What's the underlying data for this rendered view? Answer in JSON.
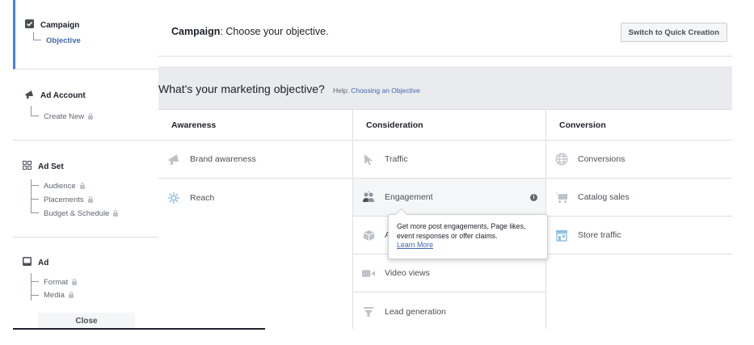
{
  "sidebar": {
    "campaign": {
      "title": "Campaign",
      "sub": "Objective"
    },
    "ad_account": {
      "title": "Ad Account",
      "sub": "Create New"
    },
    "ad_set": {
      "title": "Ad Set",
      "items": [
        "Audience",
        "Placements",
        "Budget & Schedule"
      ]
    },
    "ad": {
      "title": "Ad",
      "items": [
        "Format",
        "Media"
      ]
    },
    "close_label": "Close"
  },
  "header": {
    "title_bold": "Campaign",
    "title_rest": ": Choose your objective.",
    "quick_creation_label": "Switch to Quick Creation"
  },
  "objective": {
    "question": "What's your marketing objective?",
    "help_prefix": "Help: ",
    "help_link": "Choosing an Objective"
  },
  "columns": [
    {
      "heading": "Awareness",
      "items": [
        "Brand awareness",
        "Reach"
      ]
    },
    {
      "heading": "Consideration",
      "items": [
        "Traffic",
        "Engagement",
        "A",
        "Video views",
        "Lead generation"
      ]
    },
    {
      "heading": "Conversion",
      "items": [
        "Conversions",
        "Catalog sales",
        "Store traffic"
      ]
    }
  ],
  "tooltip": {
    "text": "Get more post engagements, Page likes, event responses or offer claims.",
    "link": "Learn More"
  },
  "colors": {
    "accent": "#4267b2",
    "active_bar": "#4080ff",
    "band_bg": "#e9ebee"
  },
  "icons": {
    "campaign": "checkbox-icon",
    "ad_account": "megaphone-icon",
    "ad_set": "grid-icon",
    "ad": "ad-square-icon"
  }
}
